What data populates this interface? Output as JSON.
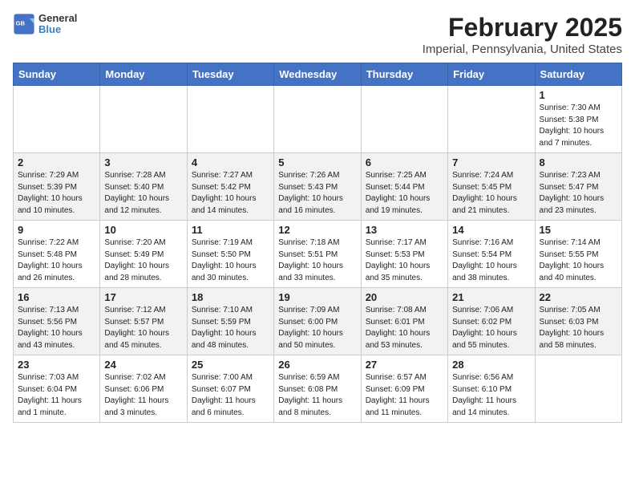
{
  "header": {
    "logo": {
      "general": "General",
      "blue": "Blue"
    },
    "title": "February 2025",
    "subtitle": "Imperial, Pennsylvania, United States"
  },
  "calendar": {
    "weekdays": [
      "Sunday",
      "Monday",
      "Tuesday",
      "Wednesday",
      "Thursday",
      "Friday",
      "Saturday"
    ],
    "weeks": [
      [
        {
          "day": "",
          "info": ""
        },
        {
          "day": "",
          "info": ""
        },
        {
          "day": "",
          "info": ""
        },
        {
          "day": "",
          "info": ""
        },
        {
          "day": "",
          "info": ""
        },
        {
          "day": "",
          "info": ""
        },
        {
          "day": "1",
          "info": "Sunrise: 7:30 AM\nSunset: 5:38 PM\nDaylight: 10 hours and 7 minutes."
        }
      ],
      [
        {
          "day": "2",
          "info": "Sunrise: 7:29 AM\nSunset: 5:39 PM\nDaylight: 10 hours and 10 minutes."
        },
        {
          "day": "3",
          "info": "Sunrise: 7:28 AM\nSunset: 5:40 PM\nDaylight: 10 hours and 12 minutes."
        },
        {
          "day": "4",
          "info": "Sunrise: 7:27 AM\nSunset: 5:42 PM\nDaylight: 10 hours and 14 minutes."
        },
        {
          "day": "5",
          "info": "Sunrise: 7:26 AM\nSunset: 5:43 PM\nDaylight: 10 hours and 16 minutes."
        },
        {
          "day": "6",
          "info": "Sunrise: 7:25 AM\nSunset: 5:44 PM\nDaylight: 10 hours and 19 minutes."
        },
        {
          "day": "7",
          "info": "Sunrise: 7:24 AM\nSunset: 5:45 PM\nDaylight: 10 hours and 21 minutes."
        },
        {
          "day": "8",
          "info": "Sunrise: 7:23 AM\nSunset: 5:47 PM\nDaylight: 10 hours and 23 minutes."
        }
      ],
      [
        {
          "day": "9",
          "info": "Sunrise: 7:22 AM\nSunset: 5:48 PM\nDaylight: 10 hours and 26 minutes."
        },
        {
          "day": "10",
          "info": "Sunrise: 7:20 AM\nSunset: 5:49 PM\nDaylight: 10 hours and 28 minutes."
        },
        {
          "day": "11",
          "info": "Sunrise: 7:19 AM\nSunset: 5:50 PM\nDaylight: 10 hours and 30 minutes."
        },
        {
          "day": "12",
          "info": "Sunrise: 7:18 AM\nSunset: 5:51 PM\nDaylight: 10 hours and 33 minutes."
        },
        {
          "day": "13",
          "info": "Sunrise: 7:17 AM\nSunset: 5:53 PM\nDaylight: 10 hours and 35 minutes."
        },
        {
          "day": "14",
          "info": "Sunrise: 7:16 AM\nSunset: 5:54 PM\nDaylight: 10 hours and 38 minutes."
        },
        {
          "day": "15",
          "info": "Sunrise: 7:14 AM\nSunset: 5:55 PM\nDaylight: 10 hours and 40 minutes."
        }
      ],
      [
        {
          "day": "16",
          "info": "Sunrise: 7:13 AM\nSunset: 5:56 PM\nDaylight: 10 hours and 43 minutes."
        },
        {
          "day": "17",
          "info": "Sunrise: 7:12 AM\nSunset: 5:57 PM\nDaylight: 10 hours and 45 minutes."
        },
        {
          "day": "18",
          "info": "Sunrise: 7:10 AM\nSunset: 5:59 PM\nDaylight: 10 hours and 48 minutes."
        },
        {
          "day": "19",
          "info": "Sunrise: 7:09 AM\nSunset: 6:00 PM\nDaylight: 10 hours and 50 minutes."
        },
        {
          "day": "20",
          "info": "Sunrise: 7:08 AM\nSunset: 6:01 PM\nDaylight: 10 hours and 53 minutes."
        },
        {
          "day": "21",
          "info": "Sunrise: 7:06 AM\nSunset: 6:02 PM\nDaylight: 10 hours and 55 minutes."
        },
        {
          "day": "22",
          "info": "Sunrise: 7:05 AM\nSunset: 6:03 PM\nDaylight: 10 hours and 58 minutes."
        }
      ],
      [
        {
          "day": "23",
          "info": "Sunrise: 7:03 AM\nSunset: 6:04 PM\nDaylight: 11 hours and 1 minute."
        },
        {
          "day": "24",
          "info": "Sunrise: 7:02 AM\nSunset: 6:06 PM\nDaylight: 11 hours and 3 minutes."
        },
        {
          "day": "25",
          "info": "Sunrise: 7:00 AM\nSunset: 6:07 PM\nDaylight: 11 hours and 6 minutes."
        },
        {
          "day": "26",
          "info": "Sunrise: 6:59 AM\nSunset: 6:08 PM\nDaylight: 11 hours and 8 minutes."
        },
        {
          "day": "27",
          "info": "Sunrise: 6:57 AM\nSunset: 6:09 PM\nDaylight: 11 hours and 11 minutes."
        },
        {
          "day": "28",
          "info": "Sunrise: 6:56 AM\nSunset: 6:10 PM\nDaylight: 11 hours and 14 minutes."
        },
        {
          "day": "",
          "info": ""
        }
      ]
    ]
  }
}
